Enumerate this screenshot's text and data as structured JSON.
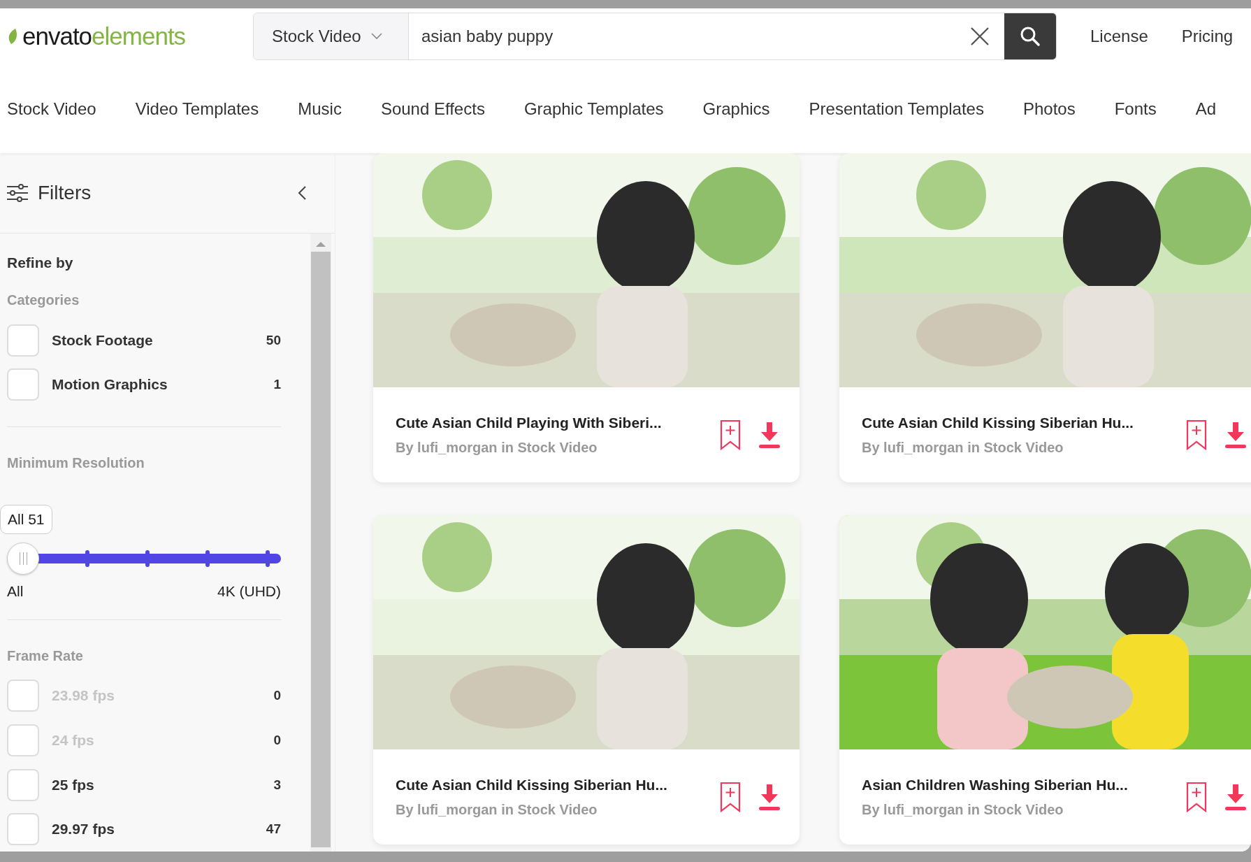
{
  "header": {
    "logo": {
      "part_1": "envato",
      "part_2": "elements"
    },
    "search": {
      "category": "Stock Video",
      "query": "asian baby puppy"
    },
    "links": [
      "License",
      "Pricing"
    ]
  },
  "nav": [
    "Stock Video",
    "Video Templates",
    "Music",
    "Sound Effects",
    "Graphic Templates",
    "Graphics",
    "Presentation Templates",
    "Photos",
    "Fonts",
    "Ad"
  ],
  "filters": {
    "title": "Filters",
    "refine_by": "Refine by",
    "categories": {
      "heading": "Categories",
      "items": [
        {
          "label": "Stock Footage",
          "count": "50",
          "checked": false,
          "disabled": false
        },
        {
          "label": "Motion Graphics",
          "count": "1",
          "checked": false,
          "disabled": false
        }
      ]
    },
    "resolution": {
      "heading": "Minimum Resolution",
      "tooltip": "All 51",
      "level": 1,
      "min_label": "All",
      "max_label": "4K (UHD)"
    },
    "frame_rate": {
      "heading": "Frame Rate",
      "items": [
        {
          "label": "23.98 fps",
          "count": "0",
          "checked": false,
          "disabled": true
        },
        {
          "label": "24 fps",
          "count": "0",
          "checked": false,
          "disabled": true
        },
        {
          "label": "25 fps",
          "count": "3",
          "checked": false,
          "disabled": false
        },
        {
          "label": "29.97 fps",
          "count": "47",
          "checked": false,
          "disabled": false
        }
      ]
    }
  },
  "results": [
    {
      "title": "Cute Asian Child Playing With Siberi...",
      "byline": "By lufi_morgan in Stock Video"
    },
    {
      "title": "Cute Asian Child Kissing Siberian Hu...",
      "byline": "By lufi_morgan in Stock Video"
    },
    {
      "title": "Cute Asian Child Kissing Siberian Hu...",
      "byline": "By lufi_morgan in Stock Video"
    },
    {
      "title": "Asian Children Washing Siberian Hu...",
      "byline": "By lufi_morgan in Stock Video"
    }
  ]
}
